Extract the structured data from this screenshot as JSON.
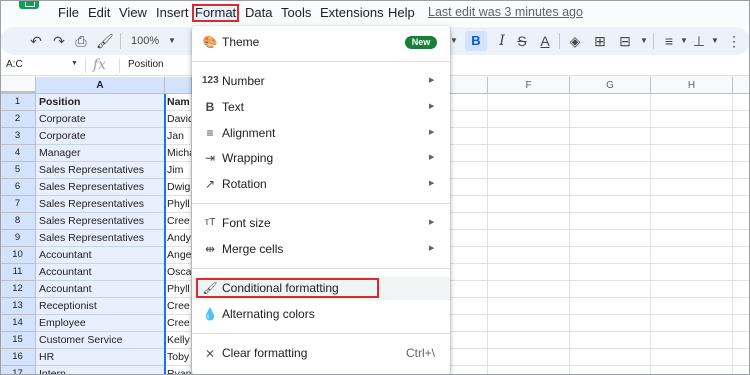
{
  "menubar": {
    "items": [
      "File",
      "Edit",
      "View",
      "Insert",
      "Format",
      "Data",
      "Tools",
      "Extensions",
      "Help"
    ],
    "last_edit": "Last edit was 3 minutes ago"
  },
  "toolbar": {
    "zoom": "100%",
    "icons": [
      "undo-icon",
      "redo-icon",
      "print-icon",
      "paint-format-icon",
      "bold-icon",
      "italic-icon",
      "strikethrough-icon",
      "text-color-icon",
      "fill-color-icon",
      "borders-icon",
      "merge-icon",
      "align-icon",
      "valign-icon",
      "more-icon"
    ],
    "bold_label": "B"
  },
  "formula_bar": {
    "namebox": "A:C",
    "fx": "fx",
    "value": "Position"
  },
  "grid": {
    "columns": [
      "A",
      "F",
      "G",
      "H"
    ],
    "rows": [
      "1",
      "2",
      "3",
      "4",
      "5",
      "6",
      "7",
      "8",
      "9",
      "10",
      "11",
      "12",
      "13",
      "14",
      "15",
      "16",
      "17"
    ],
    "col_a": [
      "Position",
      "Corporate",
      "Corporate",
      "Manager",
      "Sales Representatives",
      "Sales Representatives",
      "Sales Representatives",
      "Sales Representatives",
      "Sales Representatives",
      "Accountant",
      "Accountant",
      "Accountant",
      "Receptionist",
      "Employee",
      "Customer Service",
      "HR",
      "Intern"
    ],
    "col_b": [
      "Nam",
      "David",
      "Jan",
      "Micha",
      "Jim",
      "Dwig",
      "Phyll",
      "Cree",
      "Andy",
      "Ange",
      "Osca",
      "Phyll",
      "Cree",
      "Cree",
      "Kelly",
      "Toby",
      "Ryan"
    ]
  },
  "format_menu": {
    "theme": "Theme",
    "new_badge": "New",
    "number": "Number",
    "text": "Text",
    "alignment": "Alignment",
    "wrapping": "Wrapping",
    "rotation": "Rotation",
    "font_size": "Font size",
    "merge_cells": "Merge cells",
    "conditional_formatting": "Conditional formatting",
    "alternating_colors": "Alternating colors",
    "clear_formatting": "Clear formatting",
    "clear_shortcut": "Ctrl+\\"
  },
  "colors": {
    "highlight": "#d62c2c",
    "selection": "#1a73e8",
    "new_badge": "#188038"
  }
}
